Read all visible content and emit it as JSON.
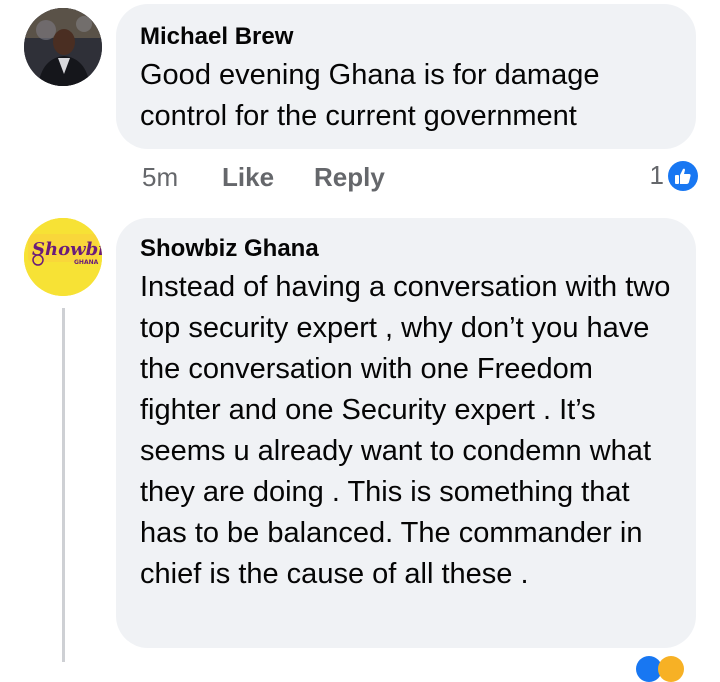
{
  "comments": [
    {
      "author": "Michael Brew",
      "text": "Good evening Ghana is for damage control for the current government",
      "time": "5m",
      "like_label": "Like",
      "reply_label": "Reply",
      "reaction_count": "1"
    },
    {
      "author": "Showbiz Ghana",
      "avatar_logo_text": "Showbiz GHANA",
      "text": "Instead of having a conversation with two top security expert , why don’t you have the conversation with one Freedom fighter and one Security expert . It’s seems u already want to condemn what they are doing . This is something that has to be balanced. The commander in chief is the cause of all these ."
    }
  ],
  "colors": {
    "bubble": "#f0f2f5",
    "meta_text": "#65676b",
    "like_blue": "#1877f2",
    "logo_yellow": "#f7e235",
    "logo_purple": "#6a1b7a"
  }
}
